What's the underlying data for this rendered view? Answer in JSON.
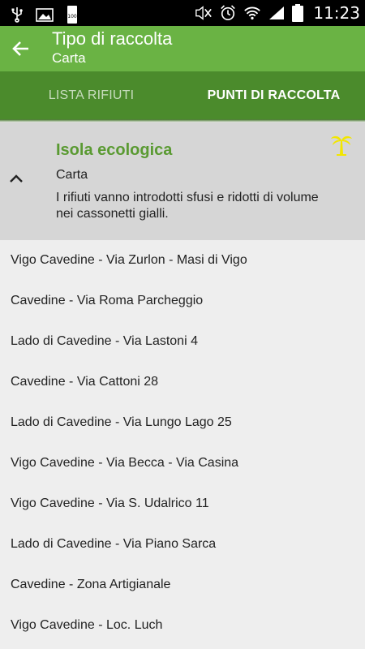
{
  "statusbar": {
    "time": "11:23",
    "battery_level_text": "100",
    "icons": [
      "usb-icon",
      "image-icon",
      "battery-level-icon",
      "mute-icon",
      "alarm-icon",
      "wifi-icon",
      "signal-icon",
      "battery-icon"
    ]
  },
  "appbar": {
    "title": "Tipo di raccolta",
    "subtitle": "Carta",
    "color": "#6ab344"
  },
  "tabs": [
    {
      "label": "LISTA RIFIUTI",
      "active": false
    },
    {
      "label": "PUNTI DI RACCOLTA",
      "active": true
    }
  ],
  "header": {
    "title": "Isola ecologica",
    "type": "Carta",
    "description": "I rifiuti vanno introdotti sfusi e ridotti di volume nei cassonetti gialli.",
    "accent_color": "#5a9a32"
  },
  "points": [
    "Vigo Cavedine - Via Zurlon - Masi di Vigo",
    "Cavedine - Via Roma Parcheggio",
    "Lado di Cavedine - Via Lastoni 4",
    "Cavedine - Via Cattoni 28",
    "Lado di Cavedine - Via Lungo Lago 25",
    "Vigo Cavedine - Via Becca - Via Casina",
    "Vigo Cavedine - Via S. Udalrico 11",
    "Lado di Cavedine - Via Piano Sarca",
    "Cavedine - Zona Artigianale",
    "Vigo Cavedine - Loc. Luch"
  ]
}
